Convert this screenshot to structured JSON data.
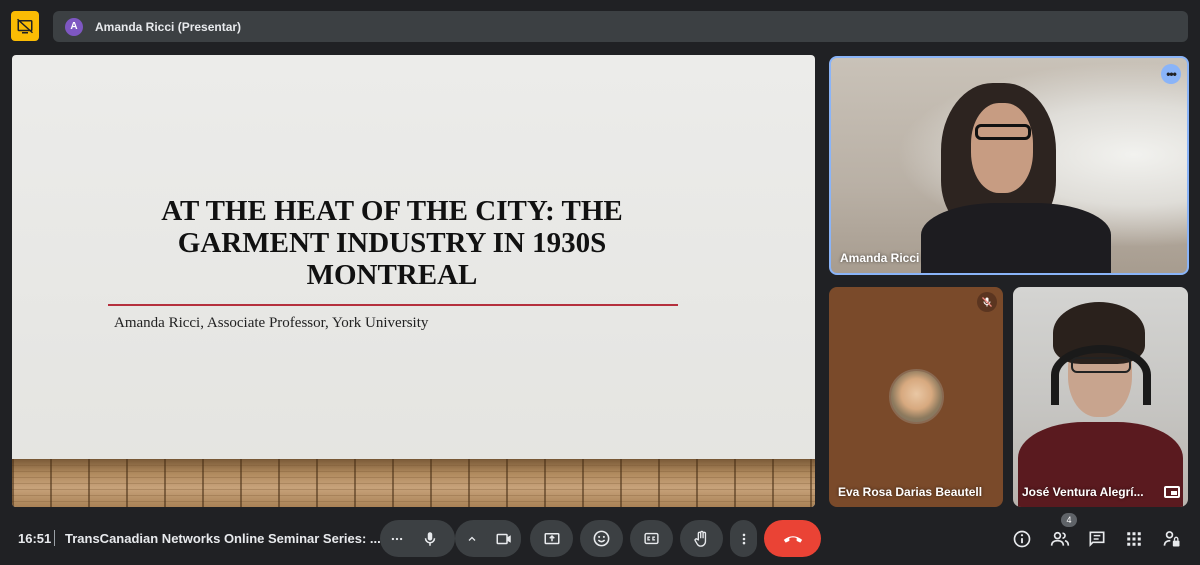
{
  "top_bar": {
    "presenter_avatar_letter": "A",
    "presenter_label": "Amanda Ricci (Presentar)"
  },
  "slide": {
    "title": "AT THE HEAT OF THE CITY: THE GARMENT INDUSTRY IN 1930S MONTREAL",
    "subtitle": "Amanda Ricci, Associate Professor, York University"
  },
  "participants": [
    {
      "name": "Amanda Ricci"
    },
    {
      "name": "Eva Rosa Darias Beautell"
    },
    {
      "name": "José Ventura Alegrí..."
    }
  ],
  "bottom_bar": {
    "time": "16:51",
    "meeting_title": "TransCanadian Networks Online Seminar Series: ...",
    "people_count": "4"
  },
  "colors": {
    "accent": "#8ab4f8",
    "end_call": "#ea4335",
    "present_toggle": "#fbbc04"
  }
}
